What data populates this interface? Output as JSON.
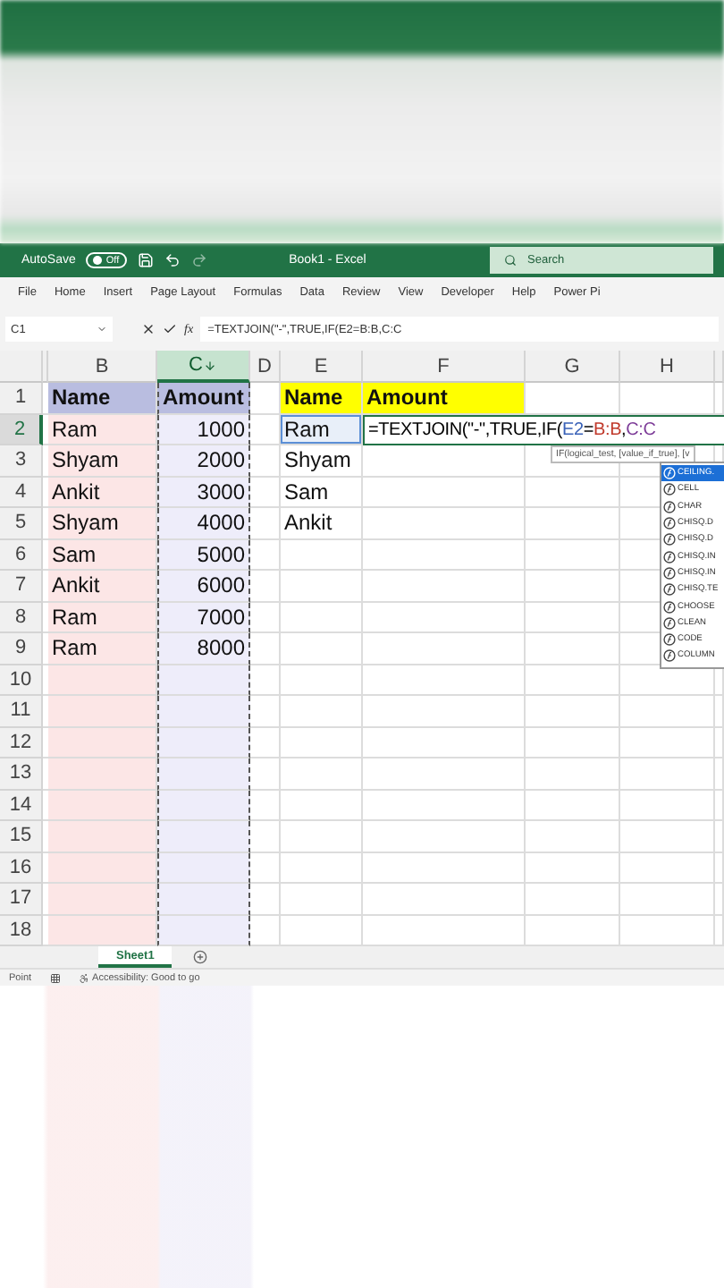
{
  "title_bar": {
    "autosave_label": "AutoSave",
    "autosave": {
      "on": false,
      "label": "Off"
    },
    "title": "Book1 - Excel",
    "search": {
      "placeholder": "Search"
    }
  },
  "menu": [
    "File",
    "Home",
    "Insert",
    "Page Layout",
    "Formulas",
    "Data",
    "Review",
    "View",
    "Developer",
    "Help",
    "Power Pi"
  ],
  "formula_bar": {
    "name_box": "C1",
    "function_label": "fx",
    "formula": "=TEXTJOIN(\"-\",TRUE,IF(E2=B:B,C:C"
  },
  "columns": [
    {
      "label": "B",
      "selected": false
    },
    {
      "label": "C",
      "selected": true
    },
    {
      "label": "D",
      "selected": false
    },
    {
      "label": "E",
      "selected": false
    },
    {
      "label": "F",
      "selected": false
    },
    {
      "label": "G",
      "selected": false
    },
    {
      "label": "H",
      "selected": false
    }
  ],
  "rows": [
    {
      "number": "1",
      "selected": false,
      "cells": {
        "b": "Name",
        "c": "Amount",
        "e": "Name",
        "f": "Amount"
      }
    },
    {
      "number": "2",
      "selected": true,
      "cells": {
        "b": "Ram",
        "c": "1000",
        "e": "Ram"
      },
      "f_segments": [
        {
          "text": "=TEXTJOIN(\"-\",TRUE,IF("
        },
        {
          "text": "E2",
          "color": "#3a62b8"
        },
        {
          "text": "="
        },
        {
          "text": "B:B",
          "color": "#c0392b"
        },
        {
          "text": ","
        },
        {
          "text": "C:C",
          "color": "#7d3c98"
        }
      ]
    },
    {
      "number": "3",
      "selected": false,
      "cells": {
        "b": "Shyam",
        "c": "2000",
        "e": "Shyam"
      }
    },
    {
      "number": "4",
      "selected": false,
      "cells": {
        "b": "Ankit",
        "c": "3000",
        "e": "Sam"
      }
    },
    {
      "number": "5",
      "selected": false,
      "cells": {
        "b": "Shyam",
        "c": "4000",
        "e": "Ankit"
      }
    },
    {
      "number": "6",
      "selected": false,
      "cells": {
        "b": "Sam",
        "c": "5000"
      }
    },
    {
      "number": "7",
      "selected": false,
      "cells": {
        "b": "Ankit",
        "c": "6000"
      }
    },
    {
      "number": "8",
      "selected": false,
      "cells": {
        "b": "Ram",
        "c": "7000"
      }
    },
    {
      "number": "9",
      "selected": false,
      "cells": {
        "b": "Ram",
        "c": "8000"
      }
    },
    {
      "number": "10",
      "selected": false,
      "cells": {}
    },
    {
      "number": "11",
      "selected": false,
      "cells": {}
    },
    {
      "number": "12",
      "selected": false,
      "cells": {}
    },
    {
      "number": "13",
      "selected": false,
      "cells": {}
    },
    {
      "number": "14",
      "selected": false,
      "cells": {}
    },
    {
      "number": "15",
      "selected": false,
      "cells": {}
    },
    {
      "number": "16",
      "selected": false,
      "cells": {}
    },
    {
      "number": "17",
      "selected": false,
      "cells": {}
    },
    {
      "number": "18",
      "selected": false,
      "cells": {}
    }
  ],
  "tooltip": "IF(logical_test, [value_if_true], [v",
  "autocomplete": [
    {
      "label": "CEILING.",
      "selected": true
    },
    {
      "label": "CELL",
      "selected": false
    },
    {
      "label": "CHAR",
      "selected": false
    },
    {
      "label": "CHISQ.D",
      "selected": false
    },
    {
      "label": "CHISQ.D",
      "selected": false
    },
    {
      "label": "CHISQ.IN",
      "selected": false
    },
    {
      "label": "CHISQ.IN",
      "selected": false
    },
    {
      "label": "CHISQ.TE",
      "selected": false
    },
    {
      "label": "CHOOSE",
      "selected": false
    },
    {
      "label": "CLEAN",
      "selected": false
    },
    {
      "label": "CODE",
      "selected": false
    },
    {
      "label": "COLUMN",
      "selected": false
    }
  ],
  "sheet_tabs": [
    {
      "label": "Sheet1",
      "selected": true
    }
  ],
  "status_bar": {
    "mode": "Point",
    "accessibility": "Accessibility: Good to go"
  }
}
